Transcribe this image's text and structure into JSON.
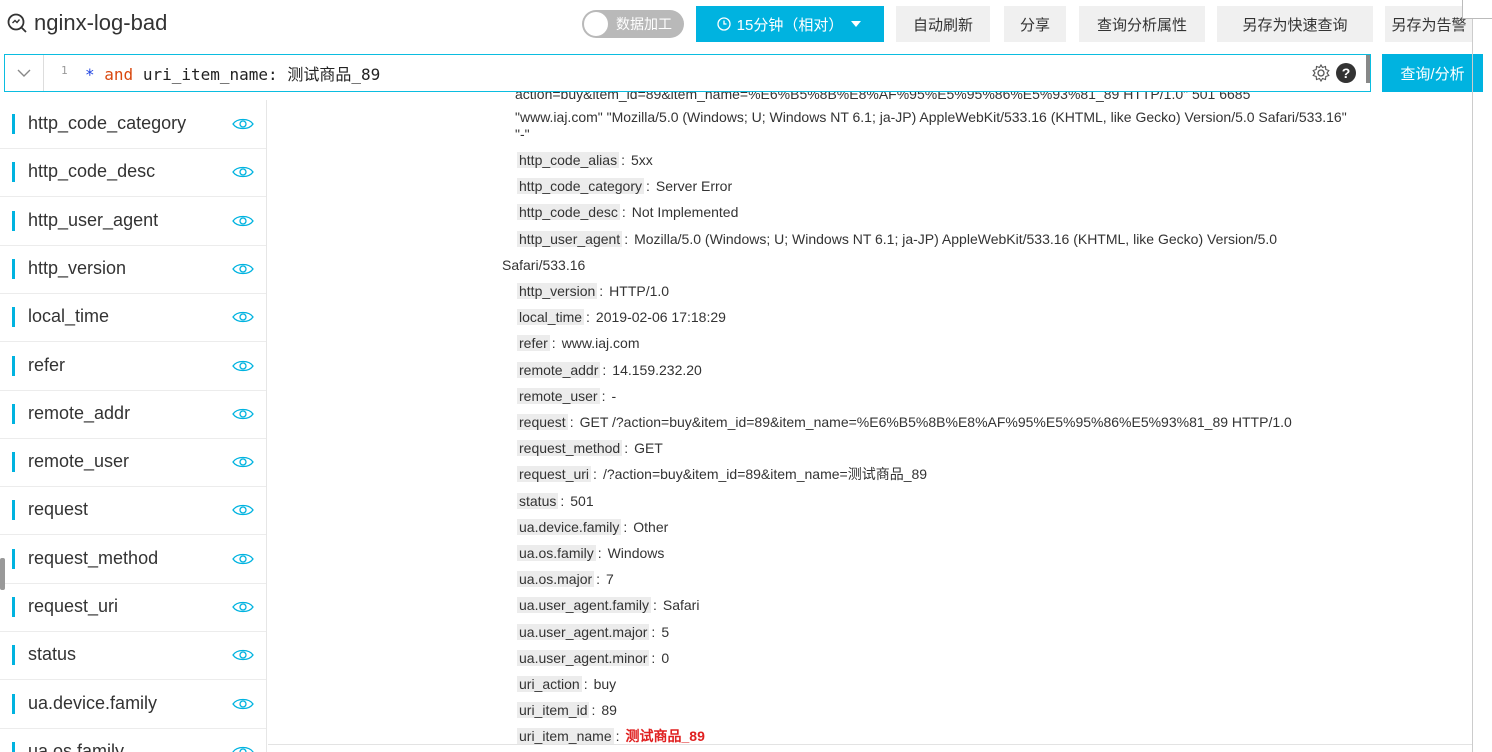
{
  "header": {
    "title": "nginx-log-bad",
    "toggle_label": "数据加工",
    "time_range": "15分钟（相对）",
    "buttons": [
      "自动刷新",
      "分享",
      "查询分析属性",
      "另存为快速查询",
      "另存为告警"
    ]
  },
  "query": {
    "line_number": "1",
    "star": "*",
    "keyword": "and",
    "rest": " uri_item_name: 测试商品_89",
    "submit_label": "查询/分析",
    "help_label": "?"
  },
  "sidebar": {
    "items": [
      "http_code_category",
      "http_code_desc",
      "http_user_agent",
      "http_version",
      "local_time",
      "refer",
      "remote_addr",
      "remote_user",
      "request",
      "request_method",
      "request_uri",
      "status",
      "ua.device.family",
      "ua.os.family"
    ]
  },
  "log": {
    "raw_lines": [
      "action=buy&item_id=89&item_name=%E6%B5%8B%E8%AF%95%E5%95%86%E5%93%81_89 HTTP/1.0\" 501 6685",
      "\"www.iaj.com\" \"Mozilla/5.0 (Windows; U; Windows NT 6.1; ja-JP) AppleWebKit/533.16 (KHTML, like Gecko) Version/5.0 Safari/533.16\"",
      "\"-\""
    ],
    "fields": [
      {
        "key": "http_code_alias",
        "value": "5xx"
      },
      {
        "key": "http_code_category",
        "value": "Server Error"
      },
      {
        "key": "http_code_desc",
        "value": "Not Implemented"
      },
      {
        "key": "http_user_agent",
        "value": "Mozilla/5.0 (Windows; U; Windows NT 6.1; ja-JP) AppleWebKit/533.16 (KHTML, like Gecko) Version/5.0"
      },
      {
        "key": "",
        "value": "Safari/533.16"
      },
      {
        "key": "http_version",
        "value": "HTTP/1.0"
      },
      {
        "key": "local_time",
        "value": "2019-02-06 17:18:29"
      },
      {
        "key": "refer",
        "value": "www.iaj.com"
      },
      {
        "key": "remote_addr",
        "value": "14.159.232.20"
      },
      {
        "key": "remote_user",
        "value": "-"
      },
      {
        "key": "request",
        "value": "GET /?action=buy&item_id=89&item_name=%E6%B5%8B%E8%AF%95%E5%95%86%E5%93%81_89 HTTP/1.0"
      },
      {
        "key": "request_method",
        "value": "GET"
      },
      {
        "key": "request_uri",
        "value": "/?action=buy&item_id=89&item_name=测试商品_89"
      },
      {
        "key": "status",
        "value": "501"
      },
      {
        "key": "ua.device.family",
        "value": "Other"
      },
      {
        "key": "ua.os.family",
        "value": "Windows"
      },
      {
        "key": "ua.os.major",
        "value": "7"
      },
      {
        "key": "ua.user_agent.family",
        "value": "Safari"
      },
      {
        "key": "ua.user_agent.major",
        "value": "5"
      },
      {
        "key": "ua.user_agent.minor",
        "value": "0"
      },
      {
        "key": "uri_action",
        "value": "buy"
      },
      {
        "key": "uri_item_id",
        "value": "89"
      },
      {
        "key": "uri_item_name",
        "value": "测试商品_89",
        "highlight": true
      }
    ]
  },
  "colors": {
    "accent": "#00b3e0",
    "highlight": "#e02020"
  }
}
